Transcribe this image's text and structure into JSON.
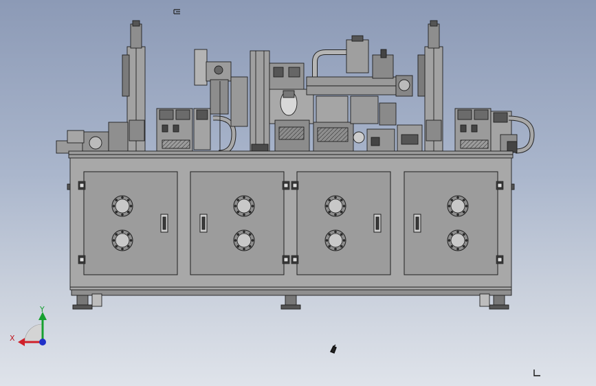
{
  "viewport": {
    "background_top": "#8c9ab6",
    "background_bottom": "#dfe3ea"
  },
  "model": {
    "frame_color": "#a7a7a7",
    "panel_color": "#9c9c9c",
    "line_color": "#1e1e1e",
    "accent_dark": "#3a3a3a",
    "door_count": 4,
    "ports_per_door": 2
  },
  "triad": {
    "x_label": "X",
    "y_label": "Y",
    "x_color": "#d0202a",
    "y_color": "#16a030",
    "z_color": "#2030c8"
  },
  "icons": [
    "view-orientation-icon",
    "cursor-glyph-icon",
    "corner-mark-icon"
  ]
}
